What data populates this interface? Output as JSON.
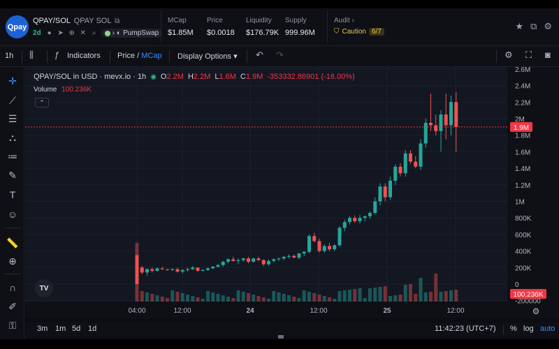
{
  "header": {
    "logo_text": "Qpay",
    "pair": "QPAY/SOL",
    "pair_sub": "QPAY SOL",
    "age": "2d",
    "dex": "PumpSwap",
    "stats": [
      {
        "label": "MCap",
        "value": "$1.85M"
      },
      {
        "label": "Price",
        "value": "$0.0018"
      },
      {
        "label": "Liquidity",
        "value": "$176.79K"
      },
      {
        "label": "Supply",
        "value": "999.96M"
      }
    ],
    "audit_label": "Audit",
    "caution_label": "Caution",
    "caution_count": "6/7"
  },
  "toolbar": {
    "interval": "1h",
    "indicators": "Indicators",
    "price": "Price",
    "mcap": "MCap",
    "display_options": "Display Options"
  },
  "legend": {
    "title": "QPAY/SOL in USD · mevx.io · 1h",
    "o_label": "O",
    "o_value": "2.2M",
    "h_label": "H",
    "h_value": "2.2M",
    "l_label": "L",
    "l_value": "1.6M",
    "c_label": "C",
    "c_value": "1.9M",
    "change": "-353332.86901 (-16.00%)",
    "volume_label": "Volume",
    "volume_value": "100.236K"
  },
  "bottom": {
    "ranges": [
      "3m",
      "1m",
      "5d",
      "1d"
    ],
    "time": "11:42:23 (UTC+7)",
    "pct": "%",
    "log": "log",
    "auto": "auto"
  },
  "chart_data": {
    "type": "candlestick",
    "y_ticks": [
      "2.6M",
      "2.4M",
      "2.2M",
      "2M",
      "1.8M",
      "1.6M",
      "1.4M",
      "1.2M",
      "1M",
      "800K",
      "600K",
      "400K",
      "200K",
      "0",
      "-200000"
    ],
    "x_ticks": [
      "04:00",
      "12:00",
      "24",
      "12:00",
      "25",
      "12:00"
    ],
    "last_price_label": "1.9M",
    "volume_label": "100.236K",
    "colors": {
      "up": "#26a69a",
      "down": "#ef5350",
      "background": "#131722"
    }
  }
}
